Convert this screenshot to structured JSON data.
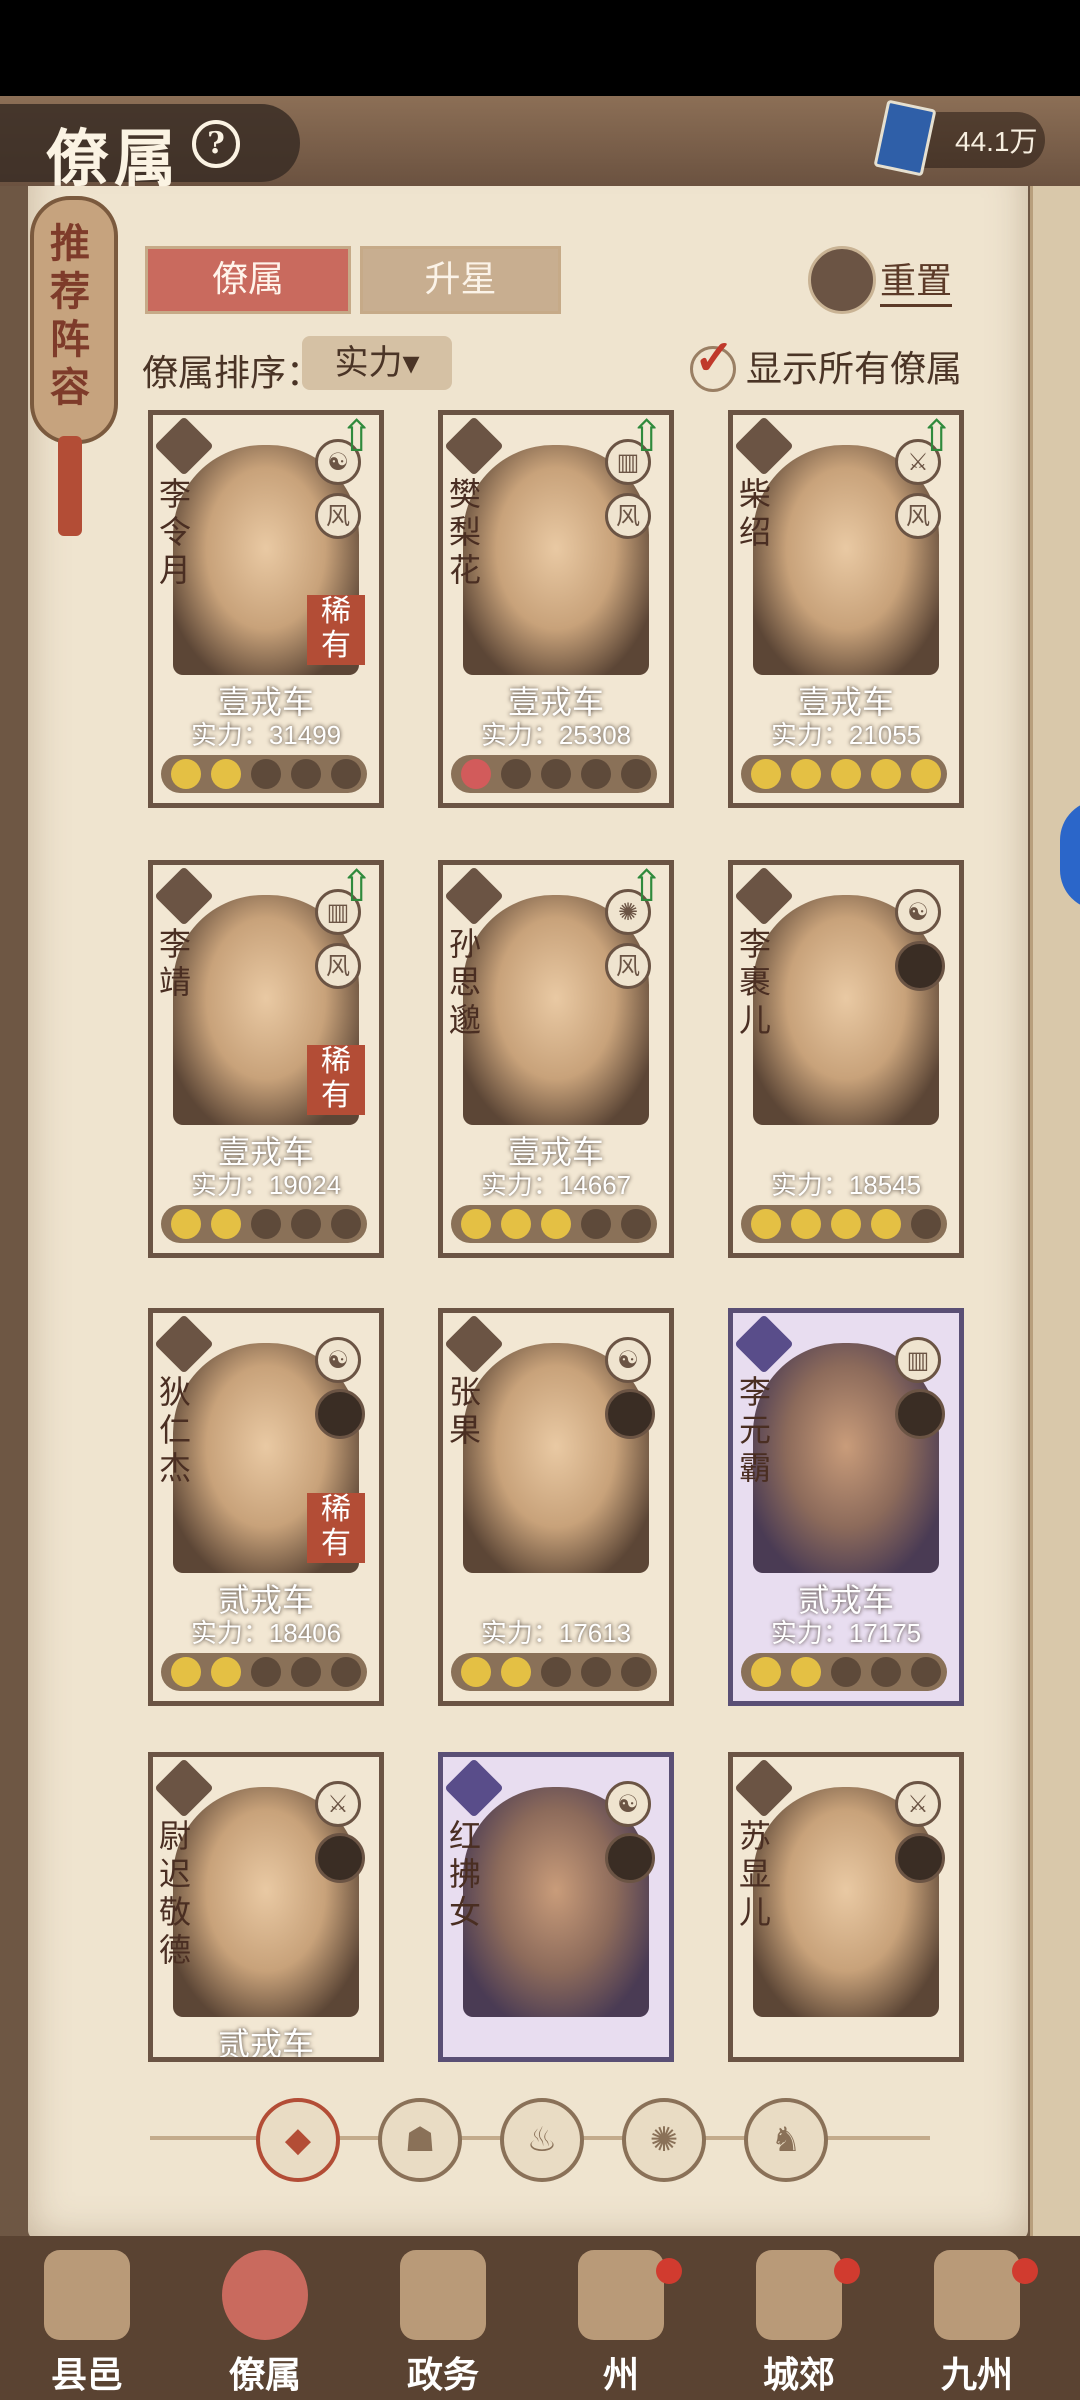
{
  "header": {
    "title": "僚属",
    "help_icon": "question-icon",
    "currency_value": "44.1万"
  },
  "side_tab": {
    "label": "推荐阵容"
  },
  "tabs": [
    {
      "label": "僚属",
      "active": true
    },
    {
      "label": "升星",
      "active": false
    }
  ],
  "reset": {
    "label": "重置",
    "icon": "reset-icon"
  },
  "sort": {
    "label": "僚属排序：",
    "value": "实力"
  },
  "show_all": {
    "label": "显示所有僚属",
    "checked": true
  },
  "cards": [
    {
      "name": "李令月",
      "rank": "壹戎车",
      "power_label": "实力：31499",
      "rare": "稀有",
      "tag": "风",
      "up": true
    },
    {
      "name": "樊梨花",
      "rank": "壹戎车",
      "power_label": "实力：25308",
      "tag": "风",
      "up": true
    },
    {
      "name": "柴绍",
      "rank": "壹戎车",
      "power_label": "实力：21055",
      "tag": "风",
      "up": true
    },
    {
      "name": "李靖",
      "rank": "壹戎车",
      "power_label": "实力：19024",
      "rare": "稀有",
      "tag": "风",
      "up": true
    },
    {
      "name": "孙思邈",
      "rank": "壹戎车",
      "power_label": "实力：14667",
      "tag": "风",
      "up": true
    },
    {
      "name": "李裹儿",
      "rank": "",
      "power_label": "实力：18545"
    },
    {
      "name": "狄仁杰",
      "rank": "贰戎车",
      "power_label": "实力：18406",
      "rare": "稀有"
    },
    {
      "name": "张果",
      "rank": "",
      "power_label": "实力：17613"
    },
    {
      "name": "李元霸",
      "rank": "贰戎车",
      "power_label": "实力：17175"
    },
    {
      "name": "尉迟敬德",
      "rank": "贰戎车",
      "power_label": ""
    },
    {
      "name": "红拂女",
      "rank": "",
      "power_label": ""
    },
    {
      "name": "苏显儿",
      "rank": "",
      "power_label": ""
    }
  ],
  "factions": [
    {
      "icon": "all-factions-icon",
      "glyph": "◆",
      "active": true
    },
    {
      "icon": "faction-bell-icon",
      "glyph": "☗"
    },
    {
      "icon": "faction-gourd-icon",
      "glyph": "♨"
    },
    {
      "icon": "faction-fan-icon",
      "glyph": "✺"
    },
    {
      "icon": "faction-lion-icon",
      "glyph": "♞"
    }
  ],
  "nav": [
    {
      "label": "县邑",
      "icon": "county-icon"
    },
    {
      "label": "僚属",
      "icon": "staff-icon",
      "active": true
    },
    {
      "label": "政务",
      "icon": "affairs-icon"
    },
    {
      "label": "州",
      "icon": "state-icon",
      "badge": true
    },
    {
      "label": "城郊",
      "icon": "suburb-icon",
      "badge": true
    },
    {
      "label": "九州",
      "icon": "nine-states-icon",
      "badge": true
    }
  ]
}
